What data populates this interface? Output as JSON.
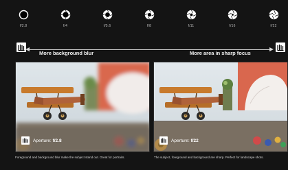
{
  "apertures": [
    {
      "label": "f/2.8",
      "icon": "closed-circle-icon"
    },
    {
      "label": "f/4",
      "icon": "aperture-icon"
    },
    {
      "label": "f/5.6",
      "icon": "aperture-icon"
    },
    {
      "label": "f/8",
      "icon": "aperture-icon"
    },
    {
      "label": "f/11",
      "icon": "aperture-icon"
    },
    {
      "label": "f/16",
      "icon": "aperture-icon"
    },
    {
      "label": "f/22",
      "icon": "aperture-icon"
    }
  ],
  "scale": {
    "left_label": "More background blur",
    "right_label": "More area in sharp focus",
    "left_icon": "scene-mode-icon",
    "right_icon": "scene-mode-icon"
  },
  "photos": [
    {
      "aperture_label": "Aperture:",
      "aperture_value": "f/2.8",
      "icon": "scene-mode-icon",
      "caption": "Foreground and background blur make the subject stand out. Great for portraits."
    },
    {
      "aperture_label": "Aperture:",
      "aperture_value": "f/22",
      "icon": "scene-mode-icon",
      "caption": "The subject, foreground and background are sharp. Perfect for landscape shots."
    }
  ],
  "colors": {
    "background": "#141414",
    "plane_wing": "#c87a2c",
    "plane_body": "#b0623a",
    "wall": "#e0e6ea",
    "table": "#8a7a6a"
  }
}
